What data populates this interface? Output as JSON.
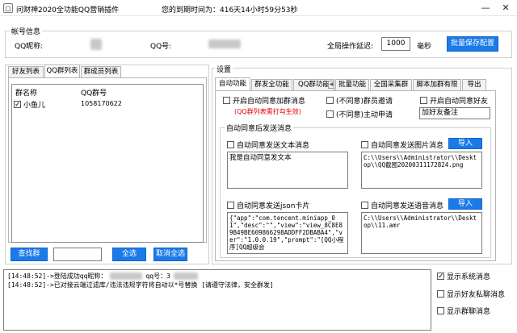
{
  "window": {
    "title": "问财神2020全功能QQ营销插件",
    "expire_label": "您的到期时间为：416天14小时59分53秒",
    "minimize": "—",
    "close": "✕"
  },
  "account": {
    "legend": "帐号信息",
    "nickname_label": "QQ昵称:",
    "qq_label": "QQ号:",
    "delay_label": "全局操作延迟:",
    "delay_value": "1000",
    "delay_unit": "毫秒",
    "save_button": "批量保存配置"
  },
  "left_panel": {
    "tabs": [
      "好友列表",
      "QQ群列表",
      "群成员列表"
    ],
    "active_tab": 1,
    "columns": [
      "群名称",
      "QQ群号"
    ],
    "rows": [
      {
        "name": "小鱼儿",
        "number": "1058170622",
        "checked": true
      }
    ],
    "find_button": "查找群",
    "search_value": "",
    "select_all_button": "全选",
    "deselect_all_button": "取消全选"
  },
  "settings": {
    "legend": "设置",
    "tabs": [
      "自动功能",
      "群发全功能",
      "QQ群功能",
      "批量功能",
      "全国采集群",
      "脚本加群有限",
      "导出"
    ],
    "active_tab": 0,
    "scroll_left": "◀",
    "scroll_right": "▶",
    "auto_join_msg": "开启自动同意加群消息",
    "auto_join_note": "(QQ群列表需打勾生效)",
    "member_invite": "(不同意)群员邀请",
    "auto_friend": "开启自动同意好友",
    "active_apply": "(不同意)主动申请",
    "friend_note_value": "加好友备注",
    "after_legend": "自动同意后发送消息",
    "send_text_label": "自动同意发送文本消息",
    "send_text_value": "我是自动同意发文本",
    "send_image_label": "自动同意发送图片消息",
    "send_image_value": "C:\\\\Users\\\\Administrator\\\\Desktop\\\\QQ截图20200311172824.png",
    "import_label": "导入",
    "send_json_label": "自动同意发送json卡片",
    "send_json_value": "{\"app\":\"com.tencent.miniapp_01\",\"desc\":\"\",\"view\":\"view_8C8E89B49BE609866298ADDFF2DBABA4\",\"ver\":\"1.0.0.19\",\"prompt\":\"[QQ小程序]QQ超级会",
    "send_voice_label": "自动同意发送语音消息",
    "send_voice_value": "C:\\\\Users\\\\Administrator\\\\Desktop\\\\11.amr"
  },
  "log": {
    "line1_prefix": "[14:48:52]->登陆成功qq昵称：",
    "line1_qq": "qq号：3",
    "line2": "[14:48:52]->已对接云端过滤库/违法违规字符将自动以*号替换 [请遵守法律，安全群发]"
  },
  "options": {
    "show_system": "显示系统消息",
    "show_friend": "显示好友私聊消息",
    "show_group": "显示群聊消息"
  }
}
